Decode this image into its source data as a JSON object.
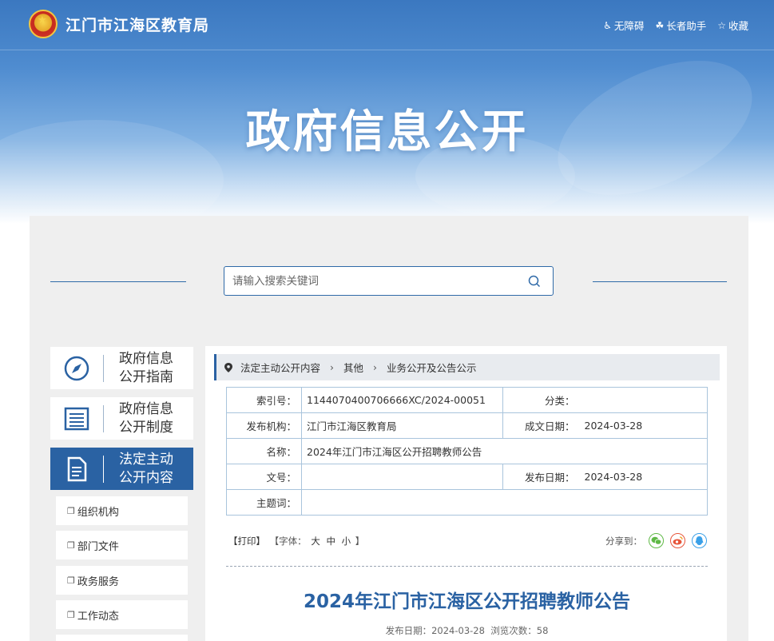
{
  "header": {
    "site_title": "江门市江海区教育局",
    "tools": [
      {
        "icon": "accessibility-icon",
        "label": "无障碍"
      },
      {
        "icon": "elder-helper-icon",
        "label": "长者助手"
      },
      {
        "icon": "star-icon",
        "label": "收藏"
      }
    ],
    "hero_title": "政府信息公开"
  },
  "search": {
    "placeholder": "请输入搜索关键词"
  },
  "nav": {
    "blocks": [
      {
        "icon": "compass-icon",
        "line1": "政府信息",
        "line2": "公开指南",
        "active": false
      },
      {
        "icon": "list-document-icon",
        "line1": "政府信息",
        "line2": "公开制度",
        "active": false
      },
      {
        "icon": "document-icon",
        "line1": "法定主动",
        "line2": "公开内容",
        "active": true
      }
    ],
    "sub_items": [
      "组织机构",
      "部门文件",
      "政务服务",
      "工作动态"
    ]
  },
  "breadcrumb": [
    "法定主动公开内容",
    "其他",
    "业务公开及公告公示"
  ],
  "meta": {
    "index_label": "索引号：",
    "index_value": "1144070400706666XC/2024-00051",
    "category_label": "分类：",
    "category_value": "",
    "publisher_label": "发布机构：",
    "publisher_value": "江门市江海区教育局",
    "created_label": "成文日期：",
    "created_value": "2024-03-28",
    "name_label": "名称：",
    "name_value": "2024年江门市江海区公开招聘教师公告",
    "docno_label": "文号：",
    "docno_value": "",
    "pubdate_label": "发布日期：",
    "pubdate_value": "2024-03-28",
    "keywords_label": "主题词：",
    "keywords_value": ""
  },
  "toolbar": {
    "print": "【打印】",
    "font_prefix": "【字体：",
    "font_large": "大",
    "font_medium": "中",
    "font_small": "小",
    "font_suffix": "】",
    "share_label": "分享到：",
    "share_icons": [
      "wechat-icon",
      "weibo-icon",
      "qq-icon"
    ]
  },
  "article": {
    "title": "2024年江门市江海区公开招聘教师公告",
    "date_label": "发布日期：",
    "date": "2024-03-28",
    "views_label": "浏览次数：",
    "views": "58"
  },
  "colors": {
    "primary": "#2a62a3",
    "panel_bg": "#efefef",
    "table_border": "#a9c4dc",
    "wechat": "#5fb946",
    "weibo": "#e7553a",
    "qq": "#3aa0e8"
  }
}
